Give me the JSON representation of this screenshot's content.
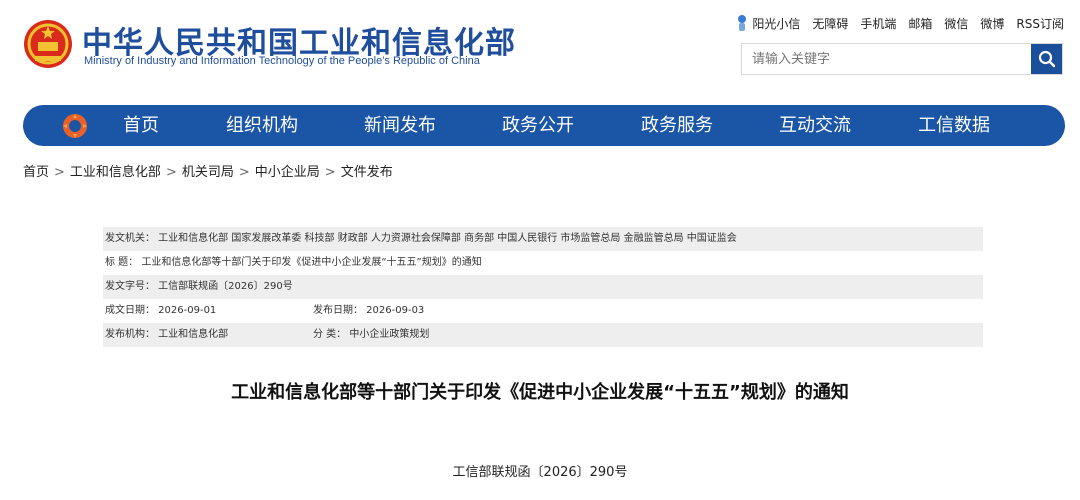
{
  "header": {
    "title_cn": "中华人民共和国工业和信息化部",
    "title_en": "Ministry of Industry and Information Technology of the People’s Republic of China",
    "toplinks": [
      "阳光小信",
      "无障碍",
      "手机端",
      "邮箱",
      "微信",
      "微博",
      "RSS订阅"
    ],
    "search_placeholder": "请输入关键字"
  },
  "nav": {
    "items": [
      "首页",
      "组织机构",
      "新闻发布",
      "政务公开",
      "政务服务",
      "互动交流",
      "工信数据"
    ]
  },
  "breadcrumb": [
    "首页",
    "工业和信息化部",
    "机关司局",
    "中小企业局",
    "文件发布"
  ],
  "breadcrumb_sep": ">",
  "info": {
    "issuer": "发文机关：  工业和信息化部 国家发展改革委 科技部 财政部 人力资源社会保障部 商务部 中国人民银行 市场监管总局 金融监管总局 中国证监会",
    "title_row": "标      题：  工业和信息化部等十部门关于印发《促进中小企业发展“十五五”规划》的通知",
    "docnum_row": "发文字号：  工信部联规函〔2026〕290号",
    "created": "成文日期：  2026-09-01",
    "published": "发布日期：  2026-09-03",
    "org": "发布机构：  工业和信息化部",
    "category": "分      类：  中小企业政策规划"
  },
  "doc": {
    "title": "工业和信息化部等十部门关于印发《促进中小企业发展“十五五”规划》的通知",
    "number": "工信部联规函〔2026〕290号"
  },
  "colors": {
    "nav": "#1a55a6",
    "brand": "#1f4e9c",
    "shade": "#eeeeee"
  }
}
